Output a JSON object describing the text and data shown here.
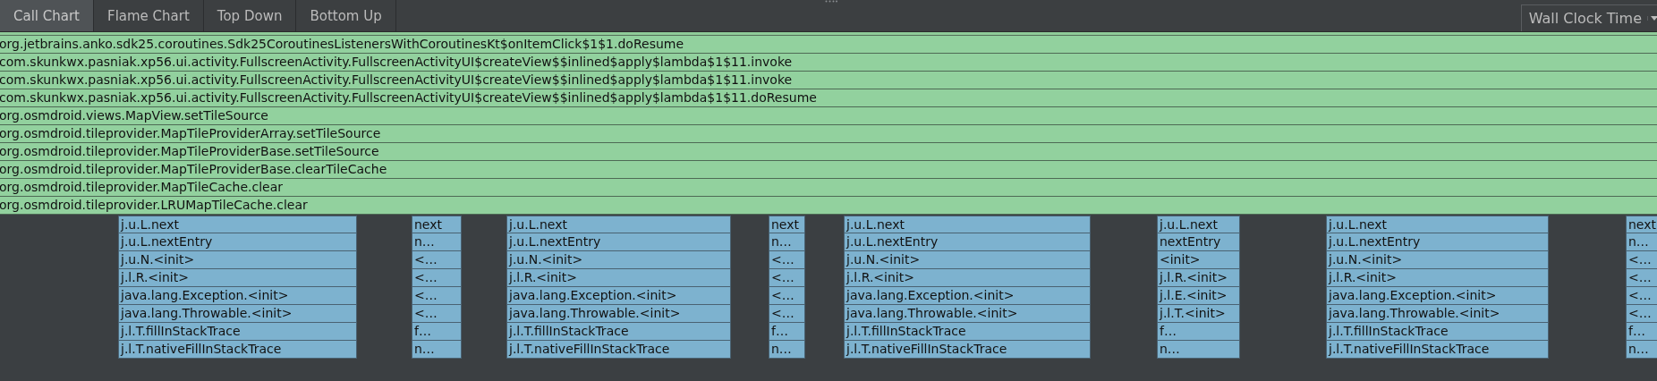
{
  "tabs": [
    {
      "label": "Call Chart",
      "selected": true
    },
    {
      "label": "Flame Chart",
      "selected": false
    },
    {
      "label": "Top Down",
      "selected": false
    },
    {
      "label": "Bottom Up",
      "selected": false
    }
  ],
  "clock_dropdown": {
    "value": "Wall Clock Time"
  },
  "top_frames": [
    "org.jetbrains.anko.sdk25.coroutines.Sdk25CoroutinesListenersWithCoroutinesKt$onItemClick$1$1.doResume",
    "com.skunkwx.pasniak.xp56.ui.activity.FullscreenActivity.FullscreenActivityUI$createView$$inlined$apply$lambda$1$11.invoke",
    "com.skunkwx.pasniak.xp56.ui.activity.FullscreenActivity.FullscreenActivityUI$createView$$inlined$apply$lambda$1$11.invoke",
    "com.skunkwx.pasniak.xp56.ui.activity.FullscreenActivity.FullscreenActivityUI$createView$$inlined$apply$lambda$1$11.doResume",
    "org.osmdroid.views.MapView.setTileSource",
    "org.osmdroid.tileprovider.MapTileProviderArray.setTileSource",
    "org.osmdroid.tileprovider.MapTileProviderBase.setTileSource",
    "org.osmdroid.tileprovider.MapTileProviderBase.clearTileCache",
    "org.osmdroid.tileprovider.MapTileCache.clear",
    "org.osmdroid.tileprovider.LRUMapTileCache.clear"
  ],
  "stacks": [
    {
      "frames": [
        "j.u.L.next",
        "j.u.L.nextEntry",
        "j.u.N.<init>",
        "j.l.R.<init>",
        "java.lang.Exception.<init>",
        "java.lang.Throwable.<init>",
        "j.l.T.fillInStackTrace",
        "j.l.T.nativeFillInStackTrace"
      ]
    },
    {
      "frames": [
        "next",
        "n…",
        "<…",
        "<…",
        "<…",
        "<…",
        "f…",
        "n…"
      ]
    },
    {
      "frames": [
        "j.u.L.next",
        "j.u.L.nextEntry",
        "j.u.N.<init>",
        "j.l.R.<init>",
        "java.lang.Exception.<init>",
        "java.lang.Throwable.<init>",
        "j.l.T.fillInStackTrace",
        "j.l.T.nativeFillInStackTrace"
      ]
    },
    {
      "frames": [
        "next",
        "n…",
        "<…",
        "<…",
        "<…",
        "<…",
        "f…",
        "n…"
      ]
    },
    {
      "frames": [
        "j.u.L.next",
        "j.u.L.nextEntry",
        "j.u.N.<init>",
        "j.l.R.<init>",
        "java.lang.Exception.<init>",
        "java.lang.Throwable.<init>",
        "j.l.T.fillInStackTrace",
        "j.l.T.nativeFillInStackTrace"
      ]
    },
    {
      "frames": [
        "j.u.L.next",
        "nextEntry",
        "<init>",
        "j.l.R.<init>",
        "j.l.E.<init>",
        "j.l.T.<init>",
        "f…",
        "n…"
      ]
    },
    {
      "frames": [
        "j.u.L.next",
        "j.u.L.nextEntry",
        "j.u.N.<init>",
        "j.l.R.<init>",
        "java.lang.Exception.<init>",
        "java.lang.Throwable.<init>",
        "j.l.T.fillInStackTrace",
        "j.l.T.nativeFillInStackTrace"
      ]
    },
    {
      "frames": [
        "next",
        "n…",
        "<…",
        "<…",
        "<…",
        "<…",
        "f…",
        "n…"
      ]
    }
  ]
}
